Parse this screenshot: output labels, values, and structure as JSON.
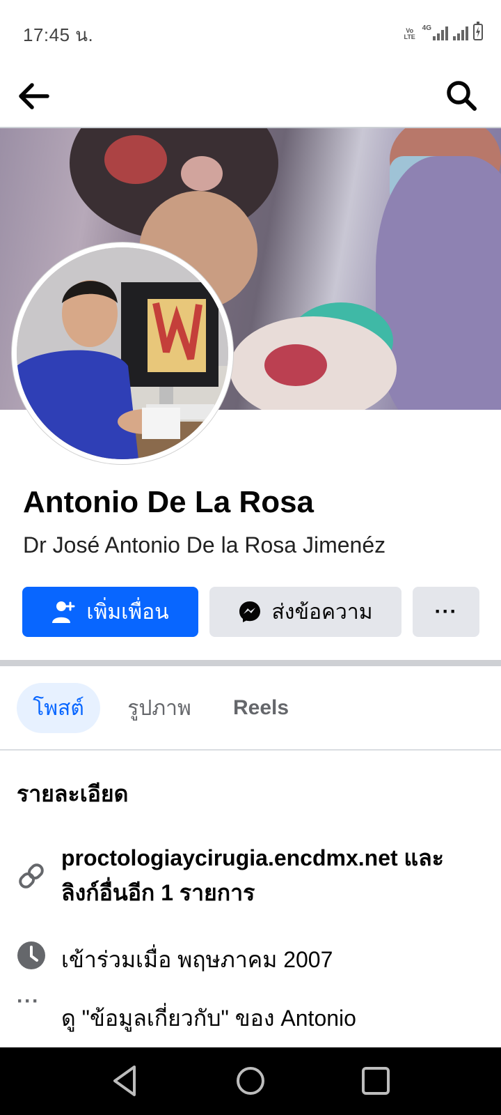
{
  "status_bar": {
    "time": "17:45 น.",
    "network_1": "Vo LTE",
    "network_2": "4G",
    "icons": [
      "volte-icon",
      "signal-icon",
      "signal-icon",
      "battery-charging-icon"
    ]
  },
  "app_bar": {
    "back_icon": "arrow-left-icon",
    "search_icon": "search-icon"
  },
  "profile": {
    "name": "Antonio De La Rosa",
    "subtitle": "Dr José Antonio De la Rosa Jimenéz"
  },
  "actions": {
    "add_friend_label": "เพิ่มเพื่อน",
    "message_label": "ส่งข้อความ",
    "more_label": "···",
    "colors": {
      "primary": "#0866ff",
      "secondary": "#e4e6eb"
    }
  },
  "tabs": [
    {
      "label": "โพสต์",
      "active": true
    },
    {
      "label": "รูปภาพ",
      "active": false
    },
    {
      "label": "Reels",
      "active": false
    }
  ],
  "details": {
    "title": "รายละเอียด",
    "link_text": "proctologiaycirugia.encdmx.net และลิงก์อื่นอีก 1 รายการ",
    "joined_text": "เข้าร่วมเมื่อ พฤษภาคม 2007",
    "about_text": "ดู \"ข้อมูลเกี่ยวกับ\" ของ Antonio",
    "more_icon_label": "···"
  },
  "nav_bar": {
    "icons": [
      "back-triangle-icon",
      "home-circle-icon",
      "recents-square-icon"
    ]
  }
}
